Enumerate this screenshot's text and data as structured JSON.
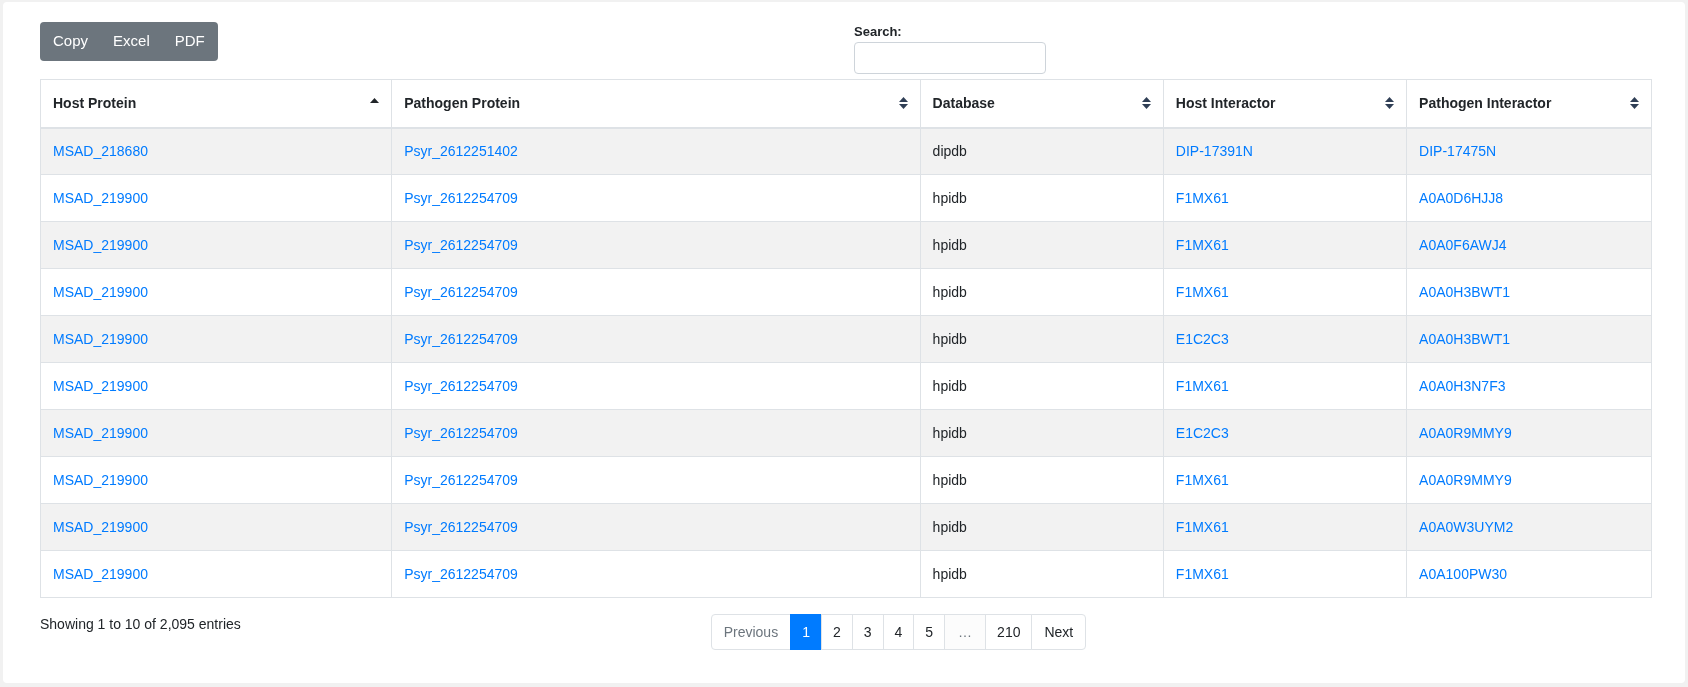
{
  "export_buttons": [
    "Copy",
    "Excel",
    "PDF"
  ],
  "search": {
    "label": "Search:"
  },
  "table": {
    "columns": [
      {
        "label": "Host Protein",
        "sorted": true,
        "links": true
      },
      {
        "label": "Pathogen Protein",
        "sorted": false,
        "links": true
      },
      {
        "label": "Database",
        "sorted": false,
        "links": false
      },
      {
        "label": "Host Interactor",
        "sorted": false,
        "links": true
      },
      {
        "label": "Pathogen Interactor",
        "sorted": false,
        "links": true
      }
    ],
    "rows": [
      [
        "MSAD_218680",
        "Psyr_2612251402",
        "dipdb",
        "DIP-17391N",
        "DIP-17475N"
      ],
      [
        "MSAD_219900",
        "Psyr_2612254709",
        "hpidb",
        "F1MX61",
        "A0A0D6HJJ8"
      ],
      [
        "MSAD_219900",
        "Psyr_2612254709",
        "hpidb",
        "F1MX61",
        "A0A0F6AWJ4"
      ],
      [
        "MSAD_219900",
        "Psyr_2612254709",
        "hpidb",
        "F1MX61",
        "A0A0H3BWT1"
      ],
      [
        "MSAD_219900",
        "Psyr_2612254709",
        "hpidb",
        "E1C2C3",
        "A0A0H3BWT1"
      ],
      [
        "MSAD_219900",
        "Psyr_2612254709",
        "hpidb",
        "F1MX61",
        "A0A0H3N7F3"
      ],
      [
        "MSAD_219900",
        "Psyr_2612254709",
        "hpidb",
        "E1C2C3",
        "A0A0R9MMY9"
      ],
      [
        "MSAD_219900",
        "Psyr_2612254709",
        "hpidb",
        "F1MX61",
        "A0A0R9MMY9"
      ],
      [
        "MSAD_219900",
        "Psyr_2612254709",
        "hpidb",
        "F1MX61",
        "A0A0W3UYM2"
      ],
      [
        "MSAD_219900",
        "Psyr_2612254709",
        "hpidb",
        "F1MX61",
        "A0A100PW30"
      ]
    ]
  },
  "info": "Showing 1 to 10 of 2,095 entries",
  "pagination": [
    {
      "label": "Previous",
      "kind": "nav",
      "disabled": true,
      "selected": false
    },
    {
      "label": "1",
      "kind": "page",
      "disabled": false,
      "selected": true
    },
    {
      "label": "2",
      "kind": "page",
      "disabled": false,
      "selected": false
    },
    {
      "label": "3",
      "kind": "page",
      "disabled": false,
      "selected": false
    },
    {
      "label": "4",
      "kind": "page",
      "disabled": false,
      "selected": false
    },
    {
      "label": "5",
      "kind": "page",
      "disabled": false,
      "selected": false
    },
    {
      "label": "…",
      "kind": "ellipsis",
      "disabled": true,
      "selected": false
    },
    {
      "label": "210",
      "kind": "page",
      "disabled": false,
      "selected": false
    },
    {
      "label": "Next",
      "kind": "nav",
      "disabled": false,
      "selected": false
    }
  ]
}
